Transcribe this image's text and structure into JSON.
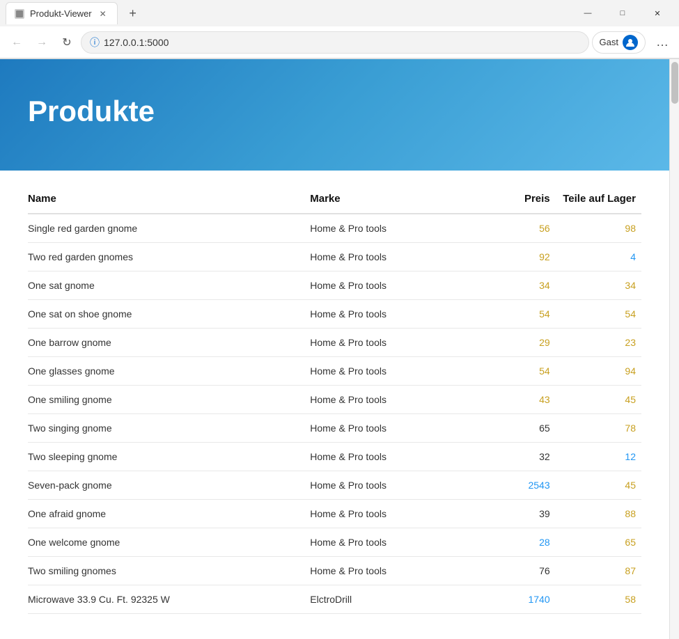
{
  "browser": {
    "tab_title": "Produkt-Viewer",
    "url": "127.0.0.1:5000",
    "user_label": "Gast",
    "new_tab_symbol": "+",
    "back_symbol": "←",
    "forward_symbol": "→",
    "refresh_symbol": "↻",
    "more_symbol": "…",
    "minimize_symbol": "—",
    "maximize_symbol": "□",
    "close_symbol": "✕"
  },
  "page": {
    "title": "Produkte"
  },
  "table": {
    "columns": [
      "Name",
      "Marke",
      "Preis",
      "Teile auf Lager"
    ],
    "rows": [
      {
        "name": "Single red garden gnome",
        "brand": "Home & Pro tools",
        "price": "56",
        "stock": "98",
        "price_class": "stock-ok",
        "stock_class": "stock-ok"
      },
      {
        "name": "Two red garden gnomes",
        "brand": "Home & Pro tools",
        "price": "92",
        "stock": "4",
        "price_class": "stock-ok",
        "stock_class": "stock-low"
      },
      {
        "name": "One sat gnome",
        "brand": "Home & Pro tools",
        "price": "34",
        "stock": "34",
        "price_class": "stock-ok",
        "stock_class": "stock-ok"
      },
      {
        "name": "One sat on shoe gnome",
        "brand": "Home & Pro tools",
        "price": "54",
        "stock": "54",
        "price_class": "stock-ok",
        "stock_class": "stock-ok"
      },
      {
        "name": "One barrow gnome",
        "brand": "Home & Pro tools",
        "price": "29",
        "stock": "23",
        "price_class": "stock-ok",
        "stock_class": "stock-ok"
      },
      {
        "name": "One glasses gnome",
        "brand": "Home & Pro tools",
        "price": "54",
        "stock": "94",
        "price_class": "stock-ok",
        "stock_class": "stock-ok"
      },
      {
        "name": "One smiling gnome",
        "brand": "Home & Pro tools",
        "price": "43",
        "stock": "45",
        "price_class": "stock-ok",
        "stock_class": "stock-ok"
      },
      {
        "name": "Two singing gnome",
        "brand": "Home & Pro tools",
        "price": "65",
        "stock": "78",
        "price_class": "stock-neutral",
        "stock_class": "stock-ok"
      },
      {
        "name": "Two sleeping gnome",
        "brand": "Home & Pro tools",
        "price": "32",
        "stock": "12",
        "price_class": "stock-neutral",
        "stock_class": "stock-low"
      },
      {
        "name": "Seven-pack gnome",
        "brand": "Home & Pro tools",
        "price": "2543",
        "stock": "45",
        "price_class": "stock-low",
        "stock_class": "stock-ok"
      },
      {
        "name": "One afraid gnome",
        "brand": "Home & Pro tools",
        "price": "39",
        "stock": "88",
        "price_class": "stock-neutral",
        "stock_class": "stock-ok"
      },
      {
        "name": "One welcome gnome",
        "brand": "Home & Pro tools",
        "price": "28",
        "stock": "65",
        "price_class": "stock-low",
        "stock_class": "stock-ok"
      },
      {
        "name": "Two smiling gnomes",
        "brand": "Home & Pro tools",
        "price": "76",
        "stock": "87",
        "price_class": "stock-neutral",
        "stock_class": "stock-ok"
      },
      {
        "name": "Microwave 33.9 Cu. Ft. 92325 W",
        "brand": "ElctroDrill",
        "price": "1740",
        "stock": "58",
        "price_class": "stock-low",
        "stock_class": "stock-ok"
      }
    ]
  }
}
